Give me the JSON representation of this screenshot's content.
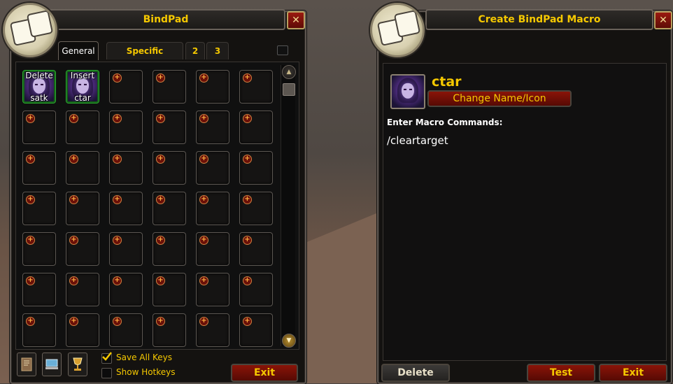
{
  "bindpad": {
    "title": "BindPad",
    "close_label": "✕",
    "tabs": [
      {
        "label": "General"
      },
      {
        "label": "Specific"
      },
      {
        "label": "2"
      },
      {
        "label": "3"
      }
    ],
    "slots": [
      {
        "key": "Delete",
        "name": "satk"
      },
      {
        "key": "Insert",
        "name": "ctar"
      }
    ],
    "plus_symbol": "+",
    "options": {
      "save_all_keys": "Save All Keys",
      "show_hotkeys": "Show Hotkeys"
    },
    "exit_label": "Exit"
  },
  "macro": {
    "title": "Create BindPad Macro",
    "close_label": "✕",
    "name": "ctar",
    "change_button": "Change Name/Icon",
    "commands_label": "Enter Macro Commands:",
    "commands": "/cleartarget",
    "delete_label": "Delete",
    "test_label": "Test",
    "exit_label": "Exit"
  },
  "colors": {
    "gold": "#f5c800",
    "button_red": "#8a1408",
    "slot_border_filled": "#2aa830"
  },
  "icons": [
    "bindpad-keys-portrait",
    "close-icon",
    "scroll-up-icon",
    "scroll-down-icon",
    "book-icon",
    "computer-icon",
    "chalice-icon",
    "checkmark-icon",
    "shadow-priest-icon"
  ]
}
